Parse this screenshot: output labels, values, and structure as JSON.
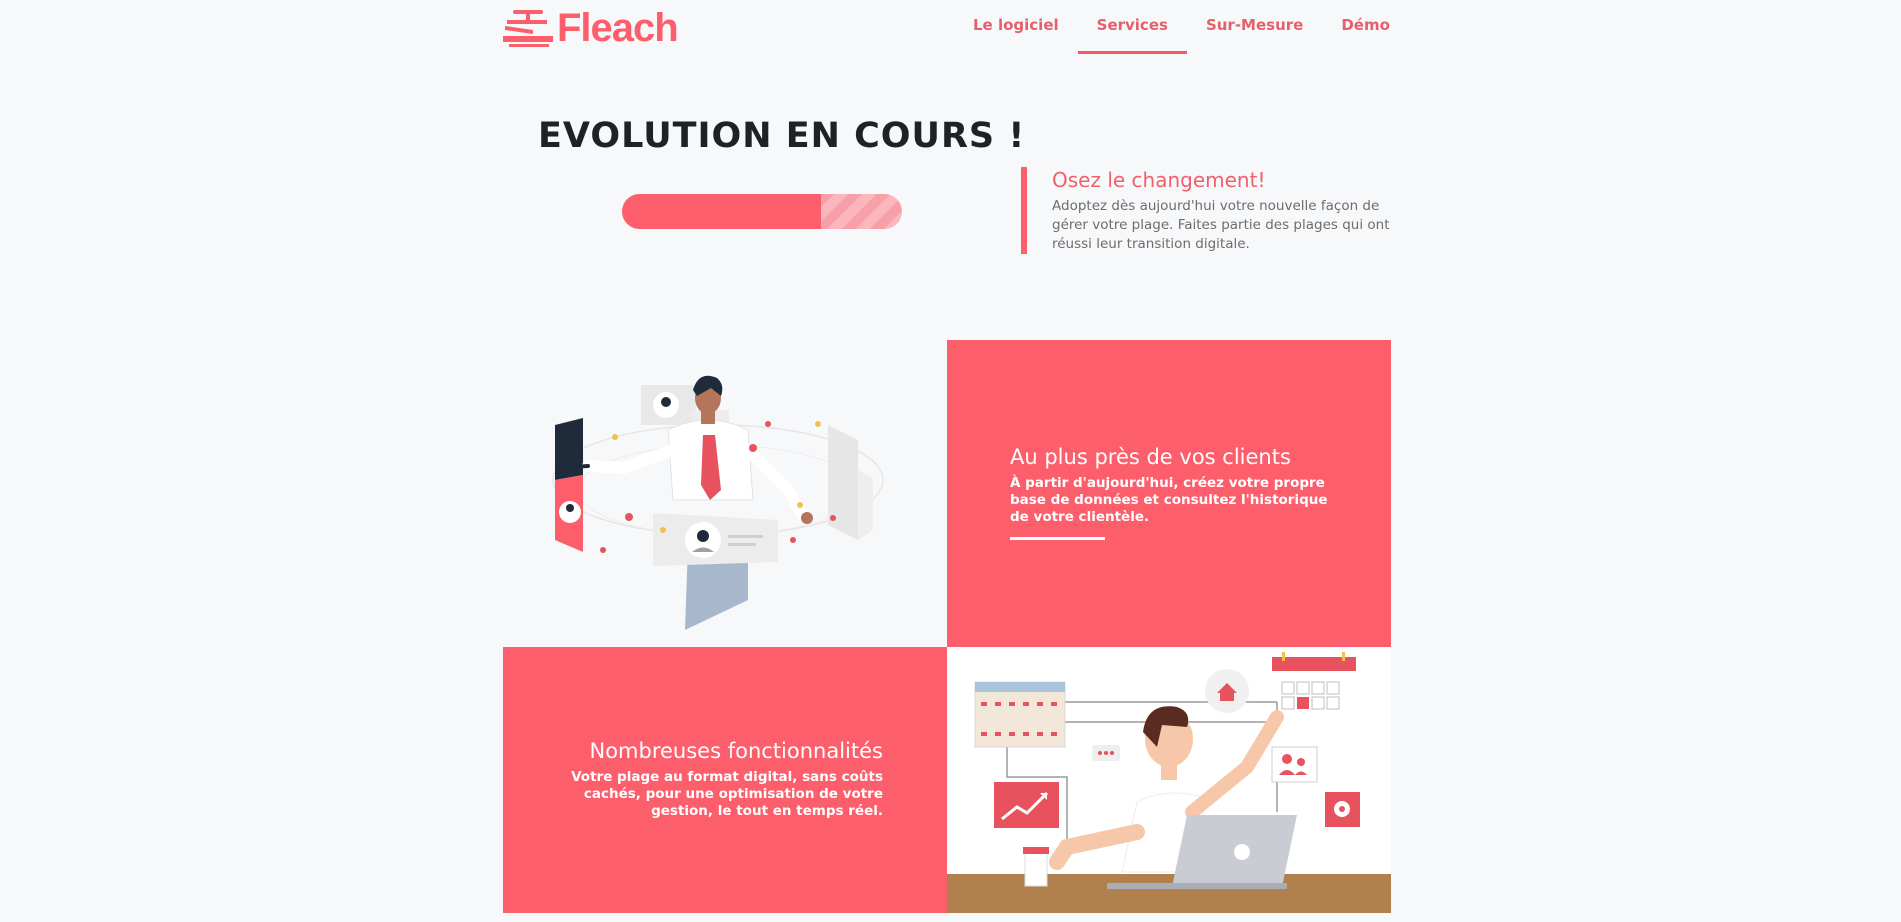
{
  "brand": {
    "name": "Fleach",
    "accent": "#fd5e6b"
  },
  "nav": {
    "items": [
      {
        "label": "Le logiciel"
      },
      {
        "label": "Services"
      },
      {
        "label": "Sur-Mesure"
      },
      {
        "label": "Démo"
      }
    ],
    "active": "Services"
  },
  "hero": {
    "title": "EVOLUTION EN COURS !",
    "progress": 0.71
  },
  "quote": {
    "title": "Osez le changement!",
    "text": "Adoptez dès aujourd'hui votre nouvelle façon de gérer votre plage. Faites partie des plages qui ont réussi leur transition digitale."
  },
  "features": [
    {
      "title": "Au plus près de vos clients",
      "text": "À partir d'aujourd'hui, créez votre propre base de données et consultez l'historique de votre clientèle."
    },
    {
      "title": "Nombreuses fonctionnalités",
      "text": "Votre plage au format digital, sans coûts cachés, pour une optimisation de votre gestion, le tout en temps réel."
    }
  ]
}
